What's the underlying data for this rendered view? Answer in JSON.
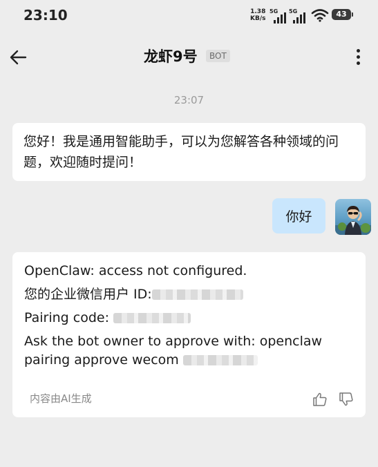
{
  "status_bar": {
    "time": "23:10",
    "speed_value": "1.38",
    "speed_unit": "KB/s",
    "network_1": "5G",
    "network_2": "5G",
    "battery": "43"
  },
  "header": {
    "title": "龙虾9号",
    "badge": "BOT"
  },
  "chat": {
    "timestamp": "23:07",
    "bot_greeting": "您好！我是通用智能助手，可以为您解答各种领域的问题，欢迎随时提问！",
    "user_message": "你好",
    "card": {
      "line1": "OpenClaw: access not configured.",
      "line2_prefix": "您的企业微信用户 ID:",
      "line3_prefix": "Pairing code:",
      "line4": "Ask the bot owner to approve with: openclaw",
      "line5_prefix": "pairing approve wecom",
      "ai_note": "内容由AI生成"
    }
  },
  "icons": {
    "back": "arrow-left-icon",
    "more": "more-vertical-icon",
    "wifi": "wifi-icon",
    "like": "thumbs-up-icon",
    "dislike": "thumbs-down-icon"
  }
}
